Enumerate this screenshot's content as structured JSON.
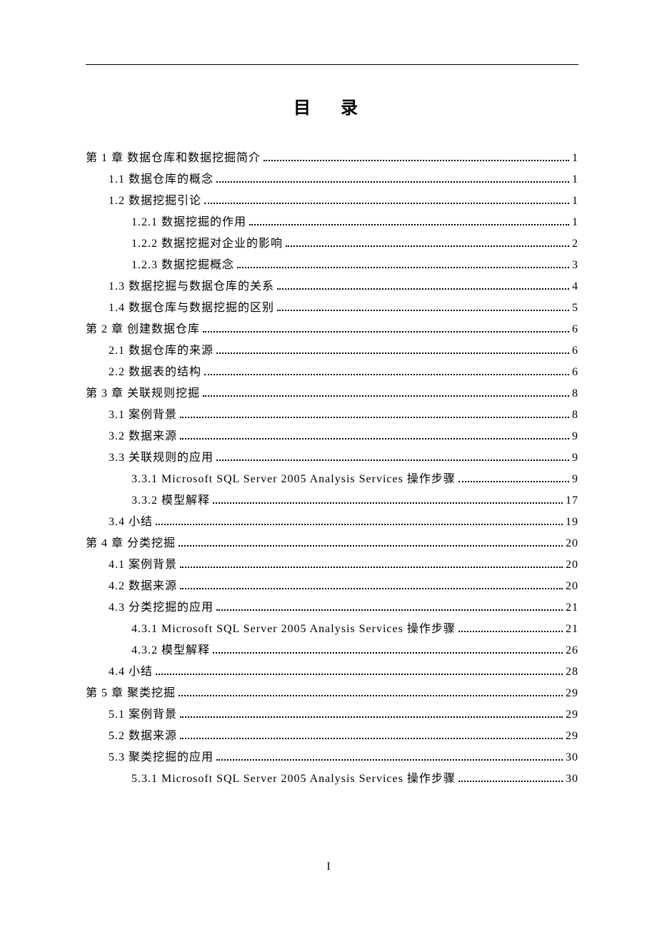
{
  "title": "目 录",
  "page_number": "I",
  "toc": [
    {
      "level": 1,
      "label": "第 1 章 数据仓库和数据挖掘简介",
      "page": "1"
    },
    {
      "level": 2,
      "label": "1.1 数据仓库的概念",
      "page": "1"
    },
    {
      "level": 2,
      "label": "1.2 数据挖掘引论",
      "page": "1"
    },
    {
      "level": 3,
      "label": "1.2.1 数据挖掘的作用",
      "page": "1"
    },
    {
      "level": 3,
      "label": "1.2.2 数据挖掘对企业的影响",
      "page": "2"
    },
    {
      "level": 3,
      "label": "1.2.3 数据挖掘概念",
      "page": "3"
    },
    {
      "level": 2,
      "label": "1.3 数据挖掘与数据仓库的关系",
      "page": "4"
    },
    {
      "level": 2,
      "label": "1.4  数据仓库与数据挖掘的区别",
      "page": "5"
    },
    {
      "level": 1,
      "label": "第 2 章 创建数据仓库",
      "page": "6"
    },
    {
      "level": 2,
      "label": "2.1 数据仓库的来源",
      "page": "6"
    },
    {
      "level": 2,
      "label": "2.2 数据表的结构",
      "page": "6"
    },
    {
      "level": 1,
      "label": "第 3 章 关联规则挖掘",
      "page": "8"
    },
    {
      "level": 2,
      "label": "3.1 案例背景",
      "page": "8"
    },
    {
      "level": 2,
      "label": "3.2 数据来源",
      "page": "9"
    },
    {
      "level": 2,
      "label": "3.3 关联规则的应用",
      "page": "9"
    },
    {
      "level": 3,
      "label": "3.3.1 Microsoft SQL Server 2005 Analysis Services 操作步骤",
      "page": "9"
    },
    {
      "level": 3,
      "label": "3.3.2 模型解释",
      "page": "17"
    },
    {
      "level": 2,
      "label": "3.4 小结",
      "page": "19"
    },
    {
      "level": 1,
      "label": "第 4 章 分类挖掘",
      "page": "20"
    },
    {
      "level": 2,
      "label": "4.1 案例背景",
      "page": "20"
    },
    {
      "level": 2,
      "label": "4.2 数据来源",
      "page": "20"
    },
    {
      "level": 2,
      "label": "4.3 分类挖掘的应用",
      "page": "21"
    },
    {
      "level": 3,
      "label": "4.3.1 Microsoft SQL Server 2005 Analysis Services 操作步骤",
      "page": "21"
    },
    {
      "level": 3,
      "label": "4.3.2 模型解释",
      "page": "26"
    },
    {
      "level": 2,
      "label": "4.4 小结",
      "page": "28"
    },
    {
      "level": 1,
      "label": "第 5 章 聚类挖掘",
      "page": "29"
    },
    {
      "level": 2,
      "label": "5.1 案例背景",
      "page": "29"
    },
    {
      "level": 2,
      "label": "5.2 数据来源",
      "page": "29"
    },
    {
      "level": 2,
      "label": "5.3 聚类挖掘的应用",
      "page": "30"
    },
    {
      "level": 3,
      "label": "5.3.1 Microsoft SQL Server 2005 Analysis Services 操作步骤",
      "page": "30"
    }
  ]
}
